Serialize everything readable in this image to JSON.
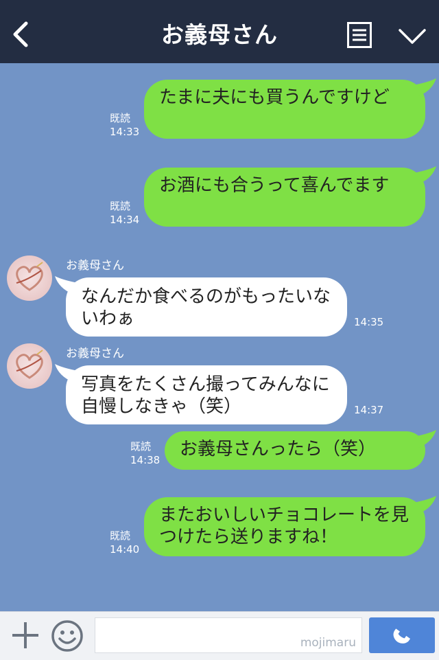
{
  "header": {
    "title": "お義母さん"
  },
  "messages": [
    {
      "direction": "out",
      "text": "たまに夫にも買うんですけど",
      "read": "既読",
      "time": "14:33"
    },
    {
      "direction": "out",
      "text": "お酒にも合うって喜んでます",
      "read": "既読",
      "time": "14:34"
    },
    {
      "direction": "in",
      "sender": "お義母さん",
      "text": "なんだか食べるのがもったいないわぁ",
      "time": "14:35"
    },
    {
      "direction": "in",
      "sender": "お義母さん",
      "text": "写真をたくさん撮ってみんなに自慢しなきゃ（笑）",
      "time": "14:37"
    },
    {
      "direction": "out",
      "text": "お義母さんったら（笑）",
      "read": "既読",
      "time": "14:38"
    },
    {
      "direction": "out",
      "text": "またおいしいチョコレートを見つけたら送りますね！",
      "read": "既読",
      "time": "14:40"
    }
  ],
  "input": {
    "watermark": "mojimaru"
  },
  "icons": {
    "back": "chevron-left-icon",
    "menu": "menu-list-icon",
    "more": "chevron-down-icon",
    "add": "plus-icon",
    "emoji": "smiley-icon",
    "call": "phone-icon"
  },
  "colors": {
    "header": "#232d42",
    "background": "#7294c6",
    "outgoing_bubble": "#7fe045",
    "incoming_bubble": "#ffffff",
    "call_button": "#4f85d8"
  }
}
